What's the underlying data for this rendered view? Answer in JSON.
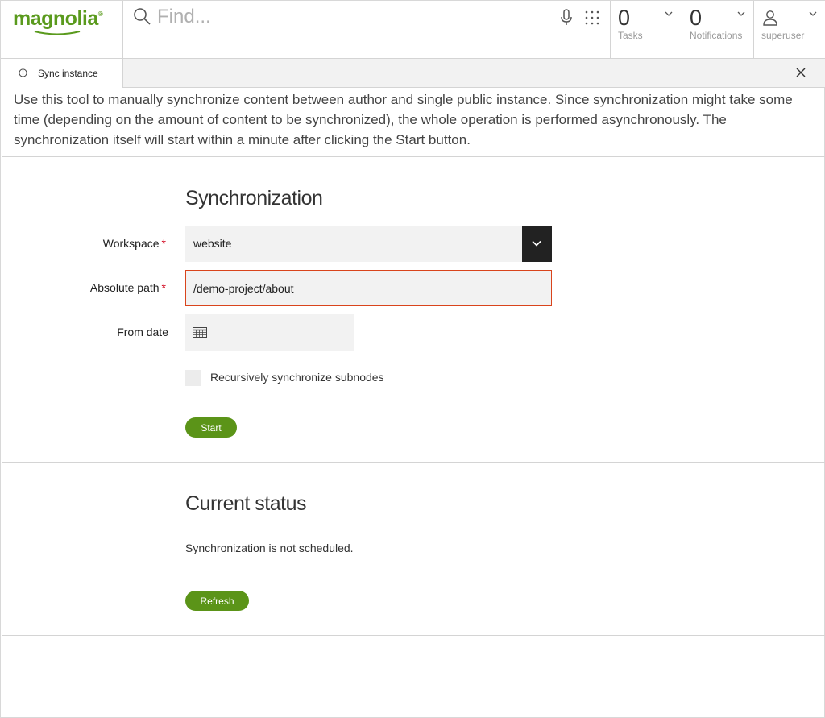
{
  "brand": {
    "name": "magnolia",
    "mark": "®"
  },
  "search": {
    "placeholder": "Find..."
  },
  "indicators": {
    "tasks": {
      "count": "0",
      "label": "Tasks"
    },
    "notifications": {
      "count": "0",
      "label": "Notifications"
    },
    "user": {
      "label": "superuser"
    }
  },
  "tab": {
    "label": "Sync instance"
  },
  "description": "Use this tool to manually synchronize content between author and single public instance. Since synchronization might take some time (depending on the amount of content to be synchronized), the whole operation is performed asynchronously. The synchronization itself will start within a minute after clicking the Start button.",
  "sync": {
    "title": "Synchronization",
    "workspace_label": "Workspace",
    "workspace_value": "website",
    "path_label": "Absolute path",
    "path_value": "/demo-project/about",
    "from_date_label": "From date",
    "recursive_label": "Recursively synchronize subnodes",
    "required_mark": "*",
    "start_label": "Start"
  },
  "status": {
    "title": "Current status",
    "message": "Synchronization is not scheduled.",
    "refresh_label": "Refresh"
  },
  "colors": {
    "brand": "#5a9a1d",
    "button": "#5b9418",
    "error": "#d9441c",
    "required": "#d0021b"
  }
}
